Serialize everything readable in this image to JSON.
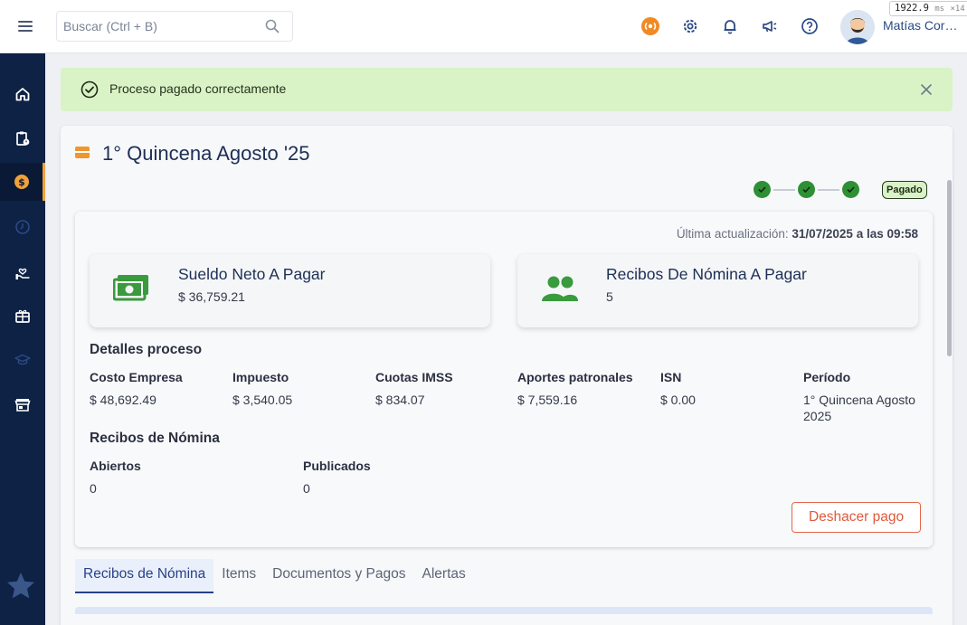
{
  "header": {
    "search_placeholder": "Buscar (Ctrl + B)",
    "user_name": "Matías Cor…",
    "perf_value": "1922.9",
    "perf_unit": "ms",
    "perf_mult": "×14",
    "icons": [
      "menu-icon",
      "search-icon",
      "broadcast-icon",
      "gear-icon",
      "bell-icon",
      "megaphone-icon",
      "help-icon"
    ]
  },
  "sidebar": {
    "items": [
      "home-icon",
      "clipboard-clock-icon",
      "dollar-coin-icon",
      "clock-icon",
      "hand-heart-icon",
      "gift-box-icon",
      "graduation-cap-icon",
      "store-icon"
    ],
    "active_index": 2,
    "accent": "#f0a13a"
  },
  "alert": {
    "message": "Proceso pagado correctamente"
  },
  "process": {
    "title": "1° Quincena Agosto '25",
    "status_badge": "Pagado",
    "steps_completed": 3,
    "steps_total": 3,
    "updated_label": "Última actualización: ",
    "updated_value": "31/07/2025 a las 09:58"
  },
  "stats": [
    {
      "title": "Sueldo Neto A Pagar",
      "value": "$ 36,759.21",
      "icon": "money-bill-icon"
    },
    {
      "title": "Recibos De Nómina A Pagar",
      "value": "5",
      "icon": "users-icon"
    }
  ],
  "details": {
    "title": "Detalles proceso",
    "fields": [
      {
        "label": "Costo Empresa",
        "value": "$ 48,692.49"
      },
      {
        "label": "Impuesto",
        "value": "$ 3,540.05"
      },
      {
        "label": "Cuotas IMSS",
        "value": "$ 834.07"
      },
      {
        "label": "Aportes patronales",
        "value": "$ 7,559.16"
      },
      {
        "label": "ISN",
        "value": "$ 0.00"
      },
      {
        "label": "Período",
        "value": "1° Quincena Agosto 2025"
      }
    ]
  },
  "receipts": {
    "title": "Recibos de Nómina",
    "fields": [
      {
        "label": "Abiertos",
        "value": "0"
      },
      {
        "label": "Publicados",
        "value": "0"
      }
    ]
  },
  "actions": {
    "undo_label": "Deshacer pago"
  },
  "tabs": [
    {
      "label": "Recibos de Nómina",
      "active": true
    },
    {
      "label": "Items",
      "active": false
    },
    {
      "label": "Documentos y Pagos",
      "active": false
    },
    {
      "label": "Alertas",
      "active": false
    }
  ],
  "colors": {
    "sidebar_bg": "#0d2244",
    "success_bg": "#d9f3c6",
    "success_green": "#2f8f35",
    "danger": "#e05a3e",
    "primary": "#27418a"
  }
}
